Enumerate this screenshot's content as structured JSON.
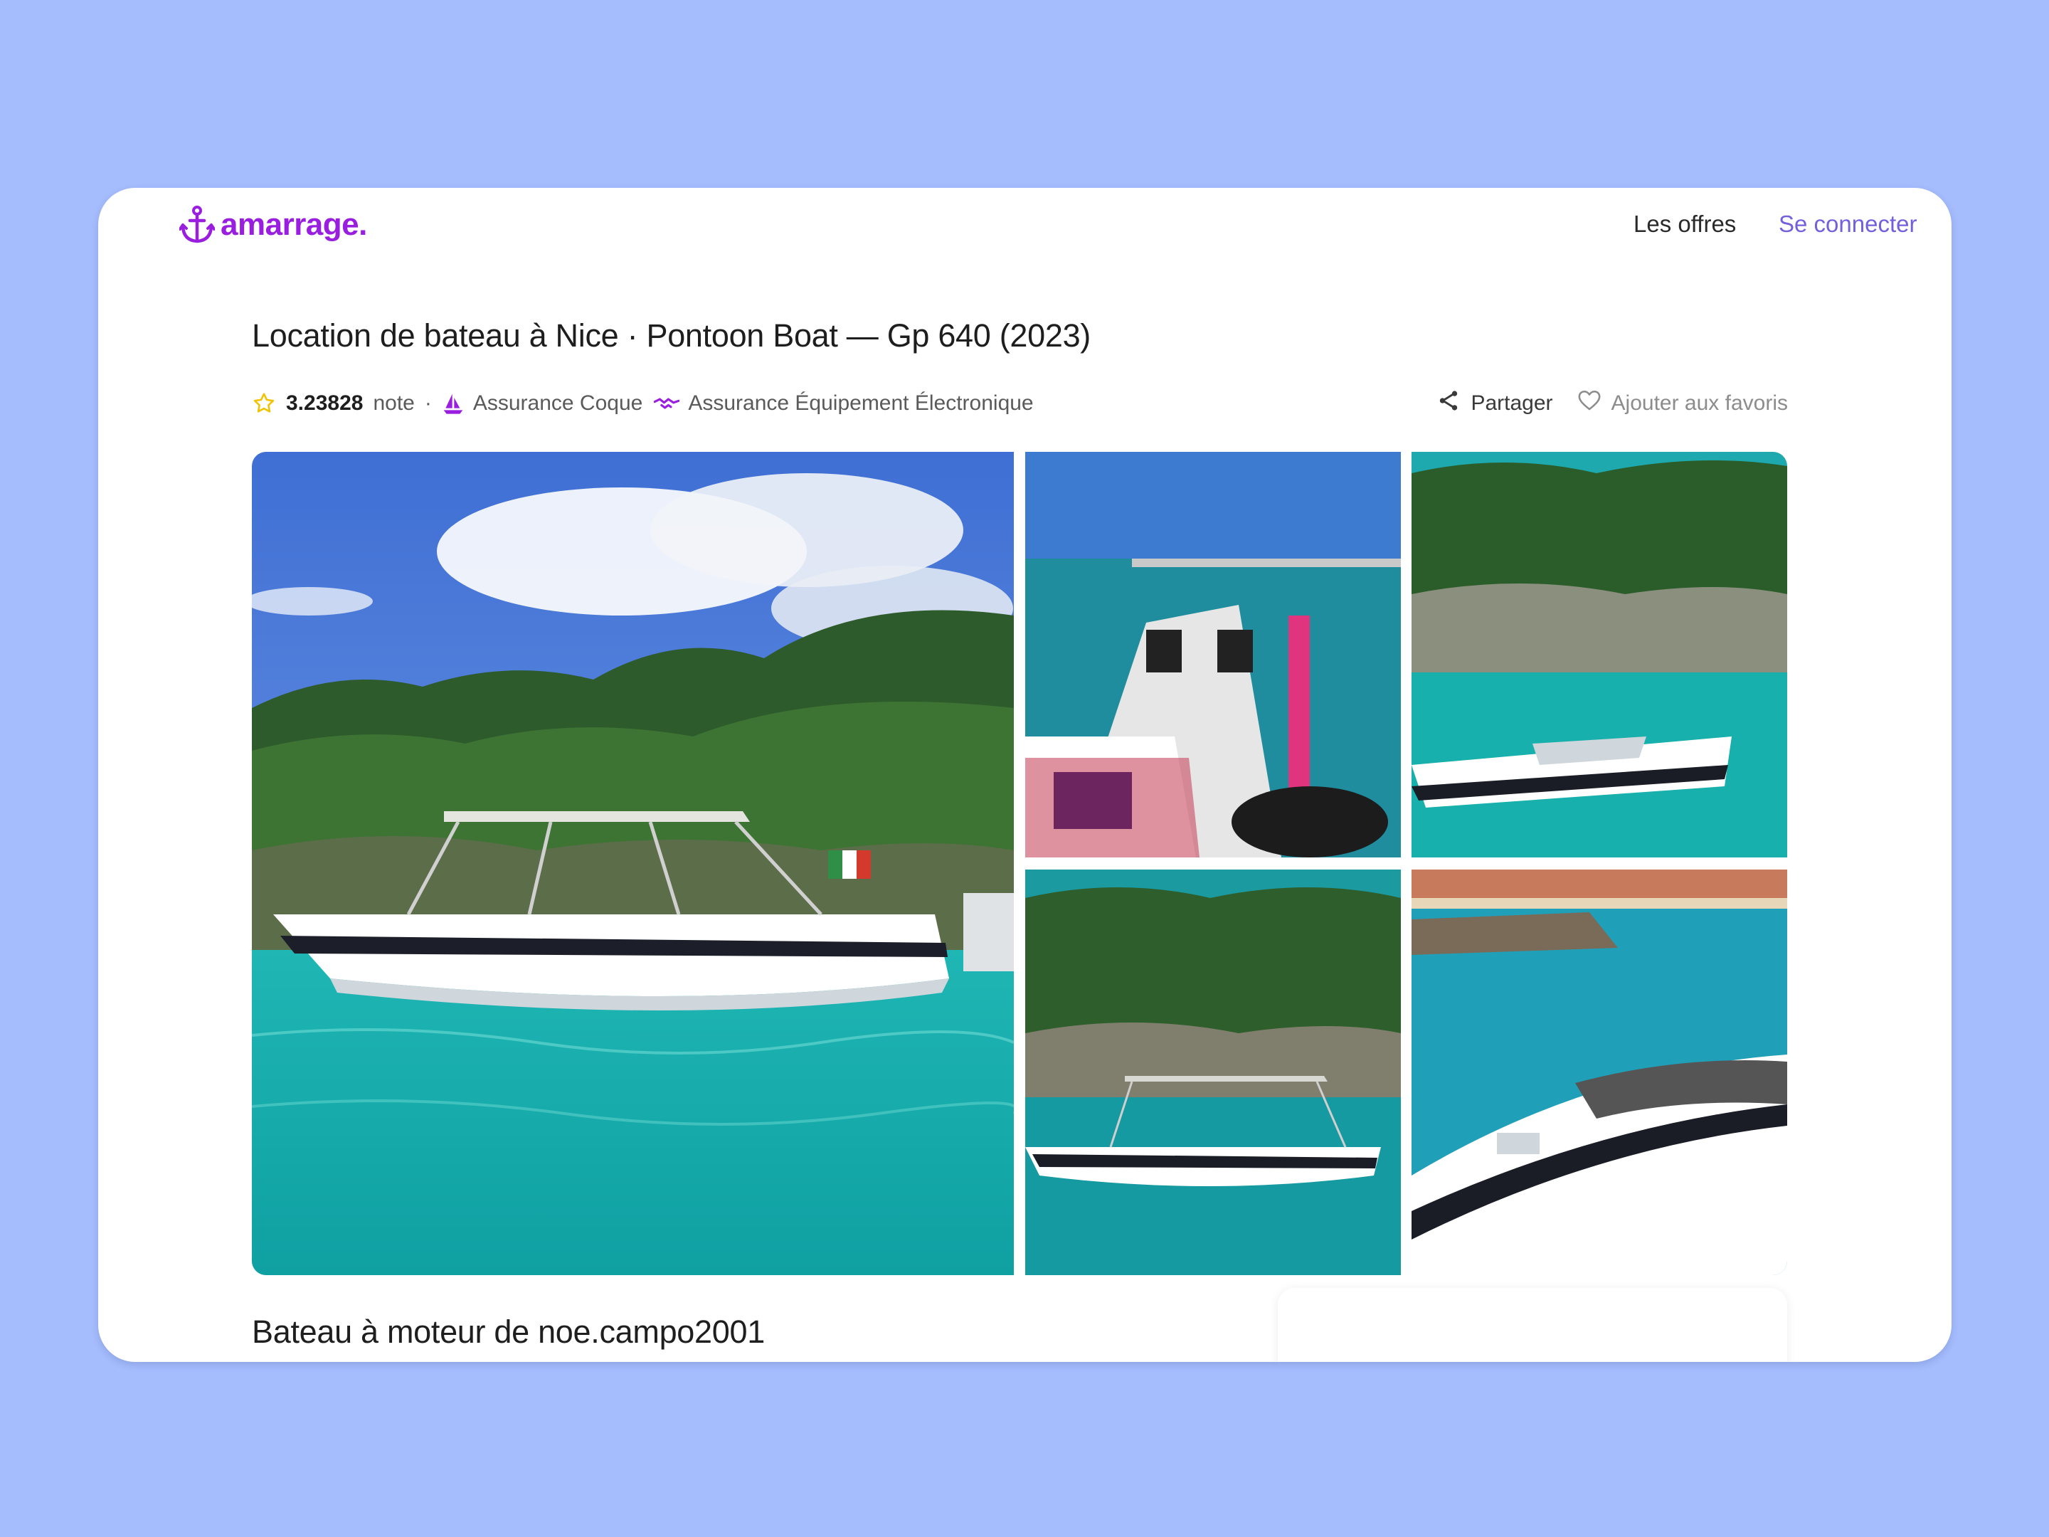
{
  "brand": {
    "name": "amarrage.",
    "color": "#9a1ee0"
  },
  "nav": {
    "offers": "Les offres",
    "login": "Se connecter"
  },
  "listing": {
    "title": "Location de bateau à Nice · Pontoon Boat — Gp 640 (2023)",
    "rating": "3.23828",
    "rating_suffix": "note",
    "separator": "·",
    "insurances": [
      "Assurance Coque",
      "Assurance Équipement Électronique"
    ],
    "subtitle": "Bateau à moteur de noe.campo2001"
  },
  "actions": {
    "share": "Partager",
    "favorite": "Ajouter aux favoris"
  },
  "icons": {
    "logo": "anchor-icon",
    "rating": "star-icon",
    "insurance_hull": "sailboat-icon",
    "insurance_electronics": "handshake-icon",
    "share": "share-icon",
    "favorite": "heart-icon"
  },
  "colors": {
    "background": "#a5bcfd",
    "accent": "#9a1ee0",
    "link": "#7460dd",
    "star": "#f2c200"
  }
}
